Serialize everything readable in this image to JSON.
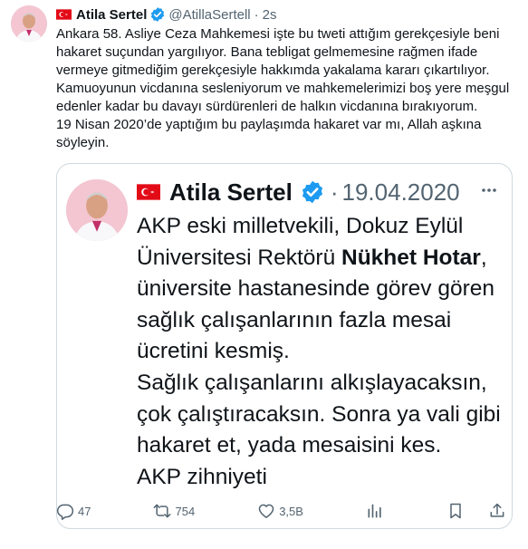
{
  "tweet": {
    "author_name": "Atila Sertel",
    "handle": "@AtillaSertell",
    "separator": "·",
    "time": "2s",
    "text_lines": [
      "Ankara 58. Asliye Ceza Mahkemesi işte bu tweti attığım gerekçesiyle beni hakaret suçundan yargılıyor. Bana tebligat gelmemesine rağmen ifade vermeye gitmediğim gerekçesiyle hakkımda yakalama kararı çıkartılıyor.",
      "Kamuoyunun vicdanına sesleniyorum ve mahkemelerimizi boş yere meşgul edenler kadar bu davayı sürdürenleri de halkın vicdanına bırakıyorum.",
      "19 Nisan 2020’de yaptığım bu paylaşımda hakaret var mı, Allah aşkına söyleyin."
    ],
    "flag_colors": {
      "red": "#e30a17",
      "white": "#ffffff"
    },
    "verified_color": "#1d9bf0"
  },
  "quote": {
    "author_name": "Atila Sertel",
    "separator": "·",
    "date": "19.04.2020",
    "more_icon": "more-dots-icon",
    "text_before": "AKP eski milletvekili, Dokuz Eylül Üniversitesi Rektörü ",
    "text_bold": "Nükhet Hotar",
    "text_after": ", üniversite hastanesinde görev gören sağlık çalışanlarının fazla mesai ücretini kesmiş.",
    "text_line2": "Sağlık çalışanlarını alkışlayacaksın, çok çalıştıracaksın. Sonra ya vali gibi hakaret et, yada mesaisini kes.",
    "text_line3": "AKP zihniyeti"
  },
  "actions": {
    "reply": {
      "icon": "reply-icon",
      "count": "47"
    },
    "retweet": {
      "icon": "retweet-icon",
      "count": "754"
    },
    "like": {
      "icon": "like-icon",
      "count": "3,5B"
    },
    "views": {
      "icon": "views-icon"
    },
    "bookmark": {
      "icon": "bookmark-icon"
    },
    "share": {
      "icon": "share-icon"
    }
  }
}
